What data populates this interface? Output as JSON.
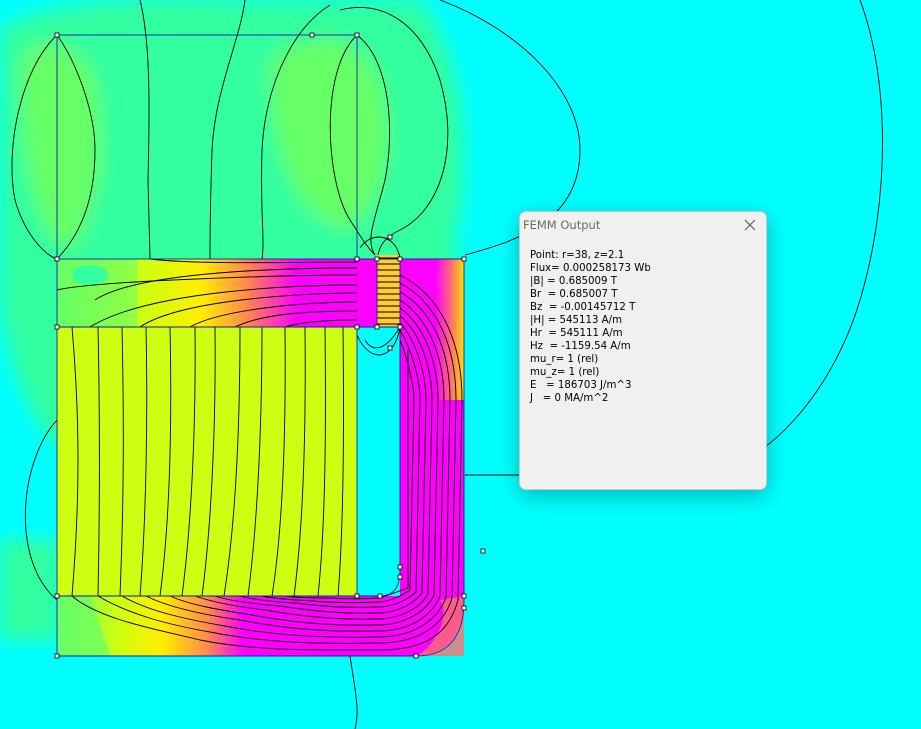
{
  "viewport": {
    "background": "#00ffff",
    "colors": {
      "low_field": "#33ffa0",
      "mid_field": "#99ff33",
      "yoke_field": "#ccff11",
      "high_field": "#ff8c4a",
      "saturated_field": "#ff00ff",
      "boundary_line": "#1a1aaa",
      "flux_line": "#000000"
    }
  },
  "femm_output": {
    "title": "FEMM Output",
    "lines": [
      "Point: r=38, z=2.1",
      "Flux= 0.000258173 Wb",
      "|B| = 0.685009 T",
      "Br  = 0.685007 T",
      "Bz  = -0.00145712 T",
      "|H| = 545113 A/m",
      "Hr  = 545111 A/m",
      "Hz  = -1159.54 A/m",
      "mu_r= 1 (rel)",
      "mu_z= 1 (rel)",
      "E   = 186703 J/m^3",
      "J   = 0 MA/m^2"
    ]
  }
}
